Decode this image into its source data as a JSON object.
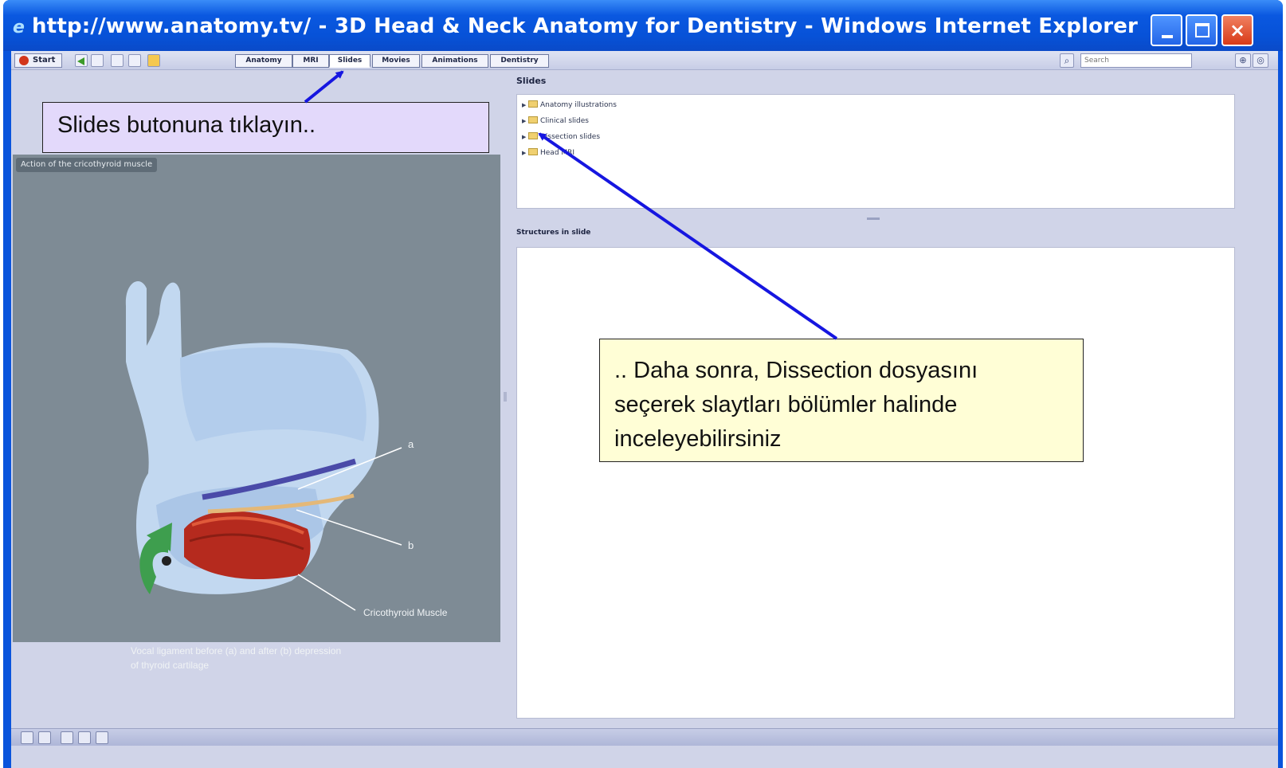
{
  "window": {
    "title": "http://www.anatomy.tv/ - 3D Head & Neck Anatomy for Dentistry - Windows Internet Explorer",
    "minimize_label": "_",
    "maximize_label": "□",
    "close_label": "×"
  },
  "toolbar": {
    "start_label": "Start",
    "tabs": [
      {
        "label": "Anatomy"
      },
      {
        "label": "MRI"
      },
      {
        "label": "Slides",
        "active": true
      },
      {
        "label": "Movies"
      },
      {
        "label": "Animations"
      },
      {
        "label": "Dentistry"
      }
    ],
    "search_placeholder": "Search"
  },
  "image_panel": {
    "caption_tag": "Action of the cricothyroid muscle",
    "label_a": "a",
    "label_b": "b",
    "label_muscle": "Cricothyroid Muscle",
    "caption_line1": "Vocal ligament before (a) and after (b) depression",
    "caption_line2": "of thyroid cartilage"
  },
  "slides_panel": {
    "title": "Slides",
    "items": [
      {
        "label": "Anatomy illustrations"
      },
      {
        "label": "Clinical slides"
      },
      {
        "label": "Dissection slides"
      },
      {
        "label": "Head MRI"
      }
    ]
  },
  "structures_panel": {
    "title": "Structures in slide"
  },
  "callouts": {
    "first": "Slides butonuna tıklayın..",
    "second_line1": ".. Daha sonra, Dissection dosyasını",
    "second_line2": "seçerek slaytları bölümler halinde",
    "second_line3": "inceleyebilirsiniz"
  },
  "colors": {
    "titlebar": "#0a58e0",
    "arrow": "#1616e0",
    "callout_first_bg": "#e3d9fb",
    "callout_second_bg": "#fffed6",
    "image_bg": "#7e8b95"
  }
}
